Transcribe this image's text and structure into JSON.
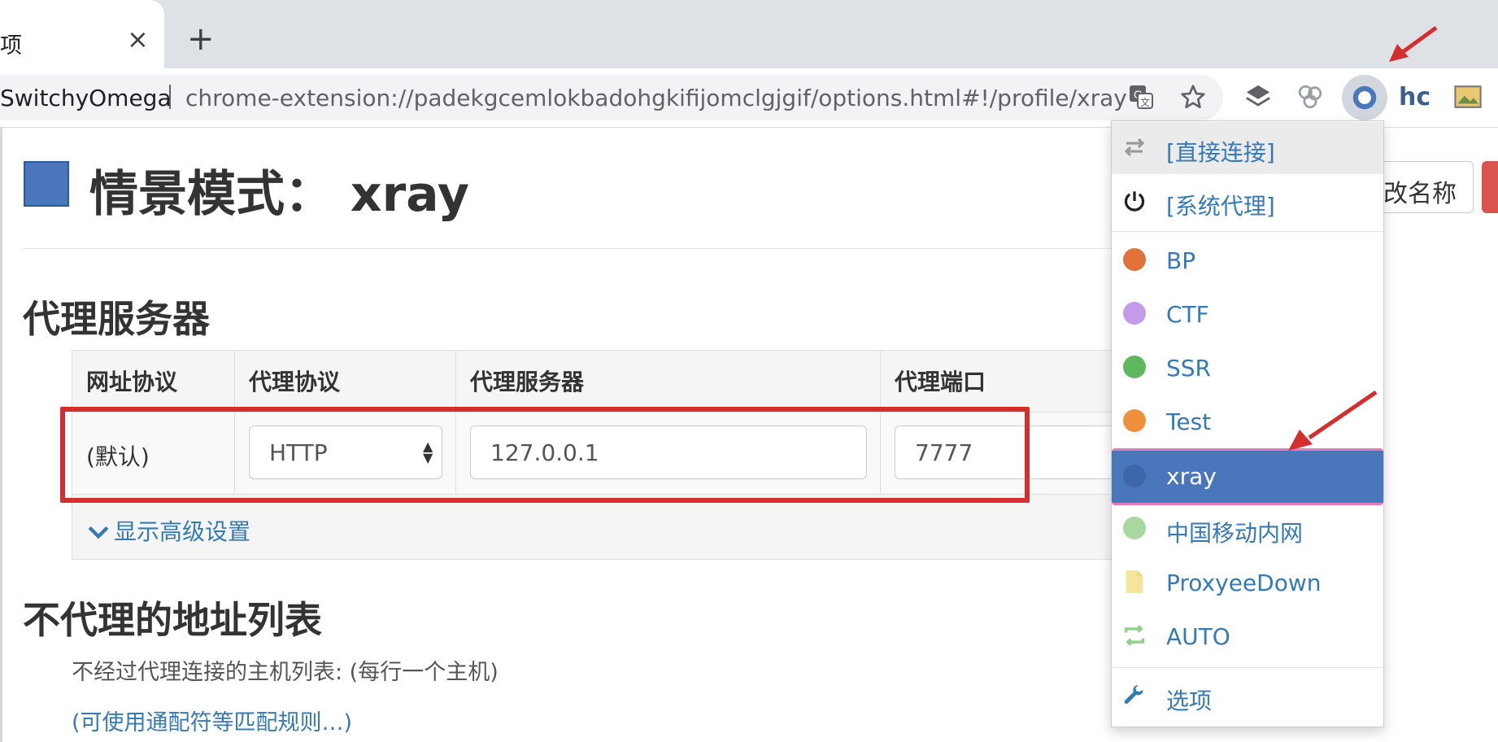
{
  "browser": {
    "tab_title": "项",
    "tab_close": "×",
    "new_tab": "+",
    "site_label": "SwitchyOmega",
    "url": "chrome-extension://padekgcemlokbadohgkifijomclgjgif/options.html#!/profile/xray",
    "profile_initials": "hc"
  },
  "page": {
    "title": "情景模式： xray",
    "rename_button": "改名称",
    "proxy_section_title": "代理服务器",
    "headers": [
      "网址协议",
      "代理协议",
      "代理服务器",
      "代理端口"
    ],
    "row": {
      "scheme": "(默认)",
      "protocol": "HTTP",
      "server": "127.0.0.1",
      "port": "7777"
    },
    "advanced_link": "显示高级设置",
    "bypass_section_title": "不代理的地址列表",
    "bypass_description": "不经过代理连接的主机列表: (每行一个主机)",
    "wildcard_link": "(可使用通配符等匹配规则…)",
    "mode_color": "#4a77bc"
  },
  "menu": {
    "items": [
      {
        "label": "[直接连接]",
        "icon": "direct-arrows-icon"
      },
      {
        "label": "[系统代理]",
        "icon": "power-icon"
      },
      {
        "label": "BP",
        "icon": "globe-icon",
        "color": "#e0723a"
      },
      {
        "label": "CTF",
        "icon": "globe-icon",
        "color": "#c39be8"
      },
      {
        "label": "SSR",
        "icon": "globe-icon",
        "color": "#5fb85c"
      },
      {
        "label": "Test",
        "icon": "globe-icon",
        "color": "#f0903c"
      },
      {
        "label": "xray",
        "icon": "globe-icon",
        "color": "#4a77bc",
        "selected": true
      },
      {
        "label": "中国移动内网",
        "icon": "globe-icon",
        "color": "#a8d8a0"
      },
      {
        "label": "ProxyeeDown",
        "icon": "file-icon",
        "color": "#f5e49a"
      },
      {
        "label": "AUTO",
        "icon": "switch-icon",
        "color": "#8fd08a"
      },
      {
        "label": "选项",
        "icon": "wrench-icon",
        "color": "#337ab7"
      }
    ]
  }
}
